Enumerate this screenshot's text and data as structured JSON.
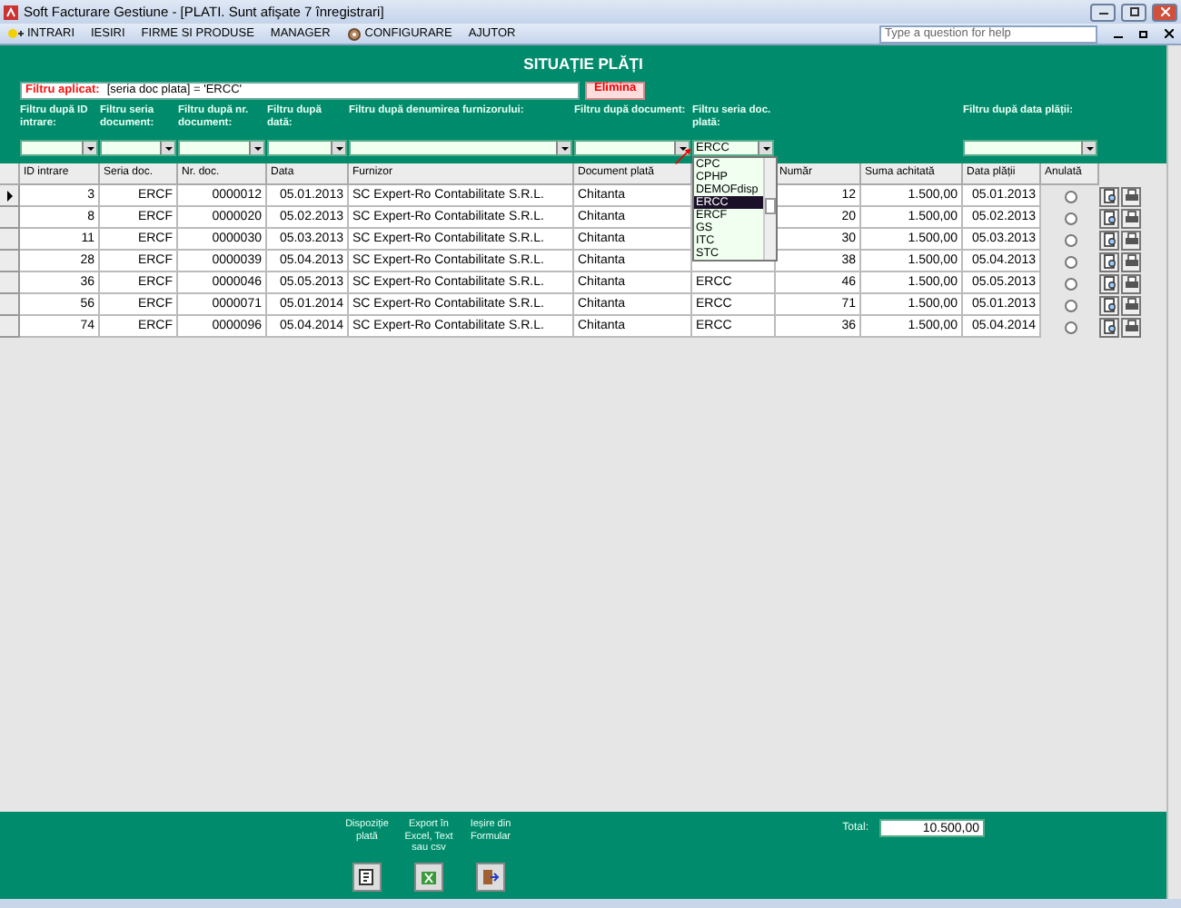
{
  "window": {
    "title": "Soft Facturare Gestiune - [PLATI. Sunt afişate 7 înregistrari]"
  },
  "menu": [
    {
      "label": "INTRARI",
      "kind": "icon"
    },
    {
      "label": "IESIRI",
      "kind": "plain"
    },
    {
      "label": "FIRME SI PRODUSE",
      "kind": "plain"
    },
    {
      "label": "MANAGER",
      "kind": "plain"
    },
    {
      "label": "CONFIGURARE",
      "kind": "icon"
    },
    {
      "label": "AJUTOR",
      "kind": "plain"
    }
  ],
  "help": {
    "placeholder": "Type a question for help"
  },
  "heading": "SITUAȚIE PLĂȚI",
  "applied_filter": {
    "label": "Filtru aplicat:",
    "value": "[seria doc plata] = 'ERCC'",
    "button": "Elimina"
  },
  "filters": [
    {
      "label": "Filtru după ID intrare:"
    },
    {
      "label": "Filtru seria document:"
    },
    {
      "label": "Filtru după nr. document:"
    },
    {
      "label": "Filtru după dată:"
    },
    {
      "label": "Filtru după denumirea furnizorului:"
    },
    {
      "label": "Filtru după document:"
    },
    {
      "label": "Filtru seria doc. plată:",
      "value": "ERCC",
      "expanded": true,
      "options": [
        {
          "label": "CPC",
          "selected": false
        },
        {
          "label": "CPHP",
          "selected": false
        },
        {
          "label": "DEMOFdisp",
          "selected": false
        },
        {
          "label": "ERCC",
          "selected": true
        },
        {
          "label": "ERCF",
          "selected": false
        },
        {
          "label": "GS",
          "selected": false
        },
        {
          "label": "ITC",
          "selected": false
        },
        {
          "label": "STC",
          "selected": false
        }
      ]
    },
    {
      "label": "Filtru după data plății:"
    }
  ],
  "table": {
    "columns": [
      "ID intrare",
      "Seria doc.",
      "Nr. doc.",
      "Data",
      "Furnizor",
      "Document plată",
      "Număr",
      "Suma achitată",
      "Data plății",
      "Anulată"
    ],
    "rows": [
      {
        "current": true,
        "id": "3",
        "series": "ERCF",
        "number": "0000012",
        "date": "05.01.2013",
        "supplier": "SC Expert-Ro Contabilitate S.R.L.",
        "document": "Chitanta",
        "pay_number": "12",
        "amount": "1.500,00",
        "pay_date": "05.01.2013",
        "cancelled": false
      },
      {
        "current": false,
        "id": "8",
        "series": "ERCF",
        "number": "0000020",
        "date": "05.02.2013",
        "supplier": "SC Expert-Ro Contabilitate S.R.L.",
        "document": "Chitanta",
        "pay_number": "20",
        "amount": "1.500,00",
        "pay_date": "05.02.2013",
        "cancelled": false
      },
      {
        "current": false,
        "id": "11",
        "series": "ERCF",
        "number": "0000030",
        "date": "05.03.2013",
        "supplier": "SC Expert-Ro Contabilitate S.R.L.",
        "document": "Chitanta",
        "pay_number": "30",
        "amount": "1.500,00",
        "pay_date": "05.03.2013",
        "cancelled": false
      },
      {
        "current": false,
        "id": "28",
        "series": "ERCF",
        "number": "0000039",
        "date": "05.04.2013",
        "supplier": "SC Expert-Ro Contabilitate S.R.L.",
        "document": "Chitanta",
        "pay_number": "38",
        "amount": "1.500,00",
        "pay_date": "05.04.2013",
        "cancelled": false
      },
      {
        "current": false,
        "id": "36",
        "series": "ERCF",
        "number": "0000046",
        "date": "05.05.2013",
        "supplier": "SC Expert-Ro Contabilitate S.R.L.",
        "document": "Chitanta",
        "pay_series": "ERCC",
        "pay_number": "46",
        "amount": "1.500,00",
        "pay_date": "05.05.2013",
        "cancelled": false
      },
      {
        "current": false,
        "id": "56",
        "series": "ERCF",
        "number": "0000071",
        "date": "05.01.2014",
        "supplier": "SC Expert-Ro Contabilitate S.R.L.",
        "document": "Chitanta",
        "pay_series": "ERCC",
        "pay_number": "71",
        "amount": "1.500,00",
        "pay_date": "05.01.2013",
        "cancelled": false
      },
      {
        "current": false,
        "id": "74",
        "series": "ERCF",
        "number": "0000096",
        "date": "05.04.2014",
        "supplier": "SC Expert-Ro Contabilitate S.R.L.",
        "document": "Chitanta",
        "pay_series": "ERCC",
        "pay_number": "36",
        "amount": "1.500,00",
        "pay_date": "05.04.2014",
        "cancelled": false
      }
    ]
  },
  "actions": [
    {
      "label": "Dispoziție plată",
      "kind": "dispose"
    },
    {
      "label": "Export în Excel, Text sau csv",
      "kind": "export"
    },
    {
      "label": "Ieșire din Formular",
      "kind": "exit"
    }
  ],
  "total": {
    "label": "Total:",
    "value": "10.500,00"
  }
}
